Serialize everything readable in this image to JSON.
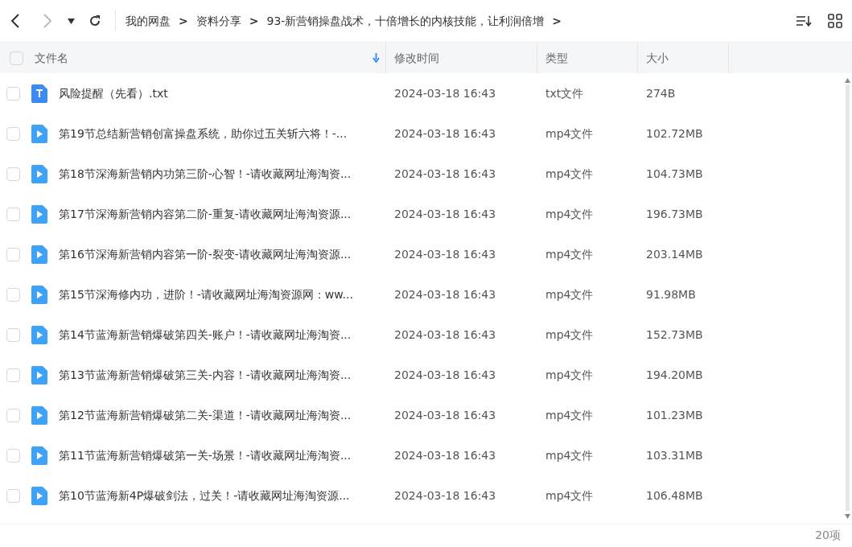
{
  "toolbar": {
    "breadcrumbs": [
      "我的网盘",
      "资料分享",
      "93-新营销操盘战术，十倍增长的内核技能，让利润倍增"
    ],
    "separator": ">"
  },
  "table": {
    "columns": [
      "文件名",
      "修改时间",
      "类型",
      "大小"
    ],
    "select_all_checked": false,
    "rows": [
      {
        "kind": "txt",
        "name": "风险提醒（先看）.txt",
        "modified": "2024-03-18 16:43",
        "type": "txt文件",
        "size": "274B",
        "checked": false
      },
      {
        "kind": "video",
        "name": "第19节总结新营销创富操盘系统，助你过五关斩六将！-...",
        "modified": "2024-03-18 16:43",
        "type": "mp4文件",
        "size": "102.72MB",
        "checked": false
      },
      {
        "kind": "video",
        "name": "第18节深海新营销内功第三阶-心智！-请收藏网址海淘资...",
        "modified": "2024-03-18 16:43",
        "type": "mp4文件",
        "size": "104.73MB",
        "checked": false
      },
      {
        "kind": "video",
        "name": "第17节深海新营销内容第二阶-重复-请收藏网址海淘资源...",
        "modified": "2024-03-18 16:43",
        "type": "mp4文件",
        "size": "196.73MB",
        "checked": false
      },
      {
        "kind": "video",
        "name": "第16节深海新营销内容第一阶-裂变-请收藏网址海淘资源...",
        "modified": "2024-03-18 16:43",
        "type": "mp4文件",
        "size": "203.14MB",
        "checked": false
      },
      {
        "kind": "video",
        "name": "第15节深海修内功，进阶！-请收藏网址海淘资源网：ww...",
        "modified": "2024-03-18 16:43",
        "type": "mp4文件",
        "size": "91.98MB",
        "checked": false
      },
      {
        "kind": "video",
        "name": "第14节蓝海新营销爆破第四关-账户！-请收藏网址海淘资...",
        "modified": "2024-03-18 16:43",
        "type": "mp4文件",
        "size": "152.73MB",
        "checked": false
      },
      {
        "kind": "video",
        "name": "第13节蓝海新营销爆破第三关-内容！-请收藏网址海淘资...",
        "modified": "2024-03-18 16:43",
        "type": "mp4文件",
        "size": "194.20MB",
        "checked": false
      },
      {
        "kind": "video",
        "name": "第12节蓝海新营销爆破第二关-渠道！-请收藏网址海淘资...",
        "modified": "2024-03-18 16:43",
        "type": "mp4文件",
        "size": "101.23MB",
        "checked": false
      },
      {
        "kind": "video",
        "name": "第11节蓝海新营销爆破第一关-场景！-请收藏网址海淘资...",
        "modified": "2024-03-18 16:43",
        "type": "mp4文件",
        "size": "103.31MB",
        "checked": false
      },
      {
        "kind": "video",
        "name": "第10节蓝海新4P爆破剑法，过关！-请收藏网址海淘资源...",
        "modified": "2024-03-18 16:43",
        "type": "mp4文件",
        "size": "106.48MB",
        "checked": false
      }
    ]
  },
  "status_bar": {
    "count": "20项"
  }
}
